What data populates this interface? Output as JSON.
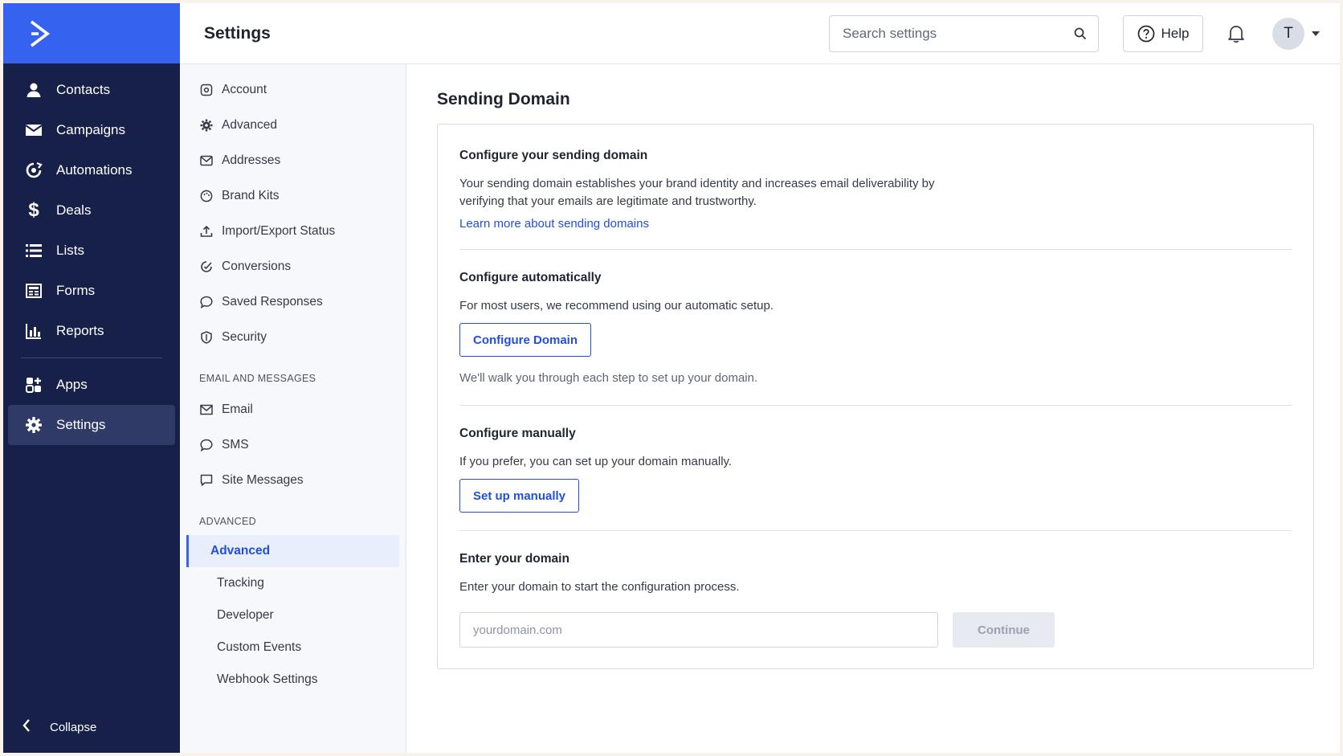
{
  "nav": {
    "items": [
      {
        "label": "Contacts",
        "icon": "person-icon"
      },
      {
        "label": "Campaigns",
        "icon": "envelope-icon"
      },
      {
        "label": "Automations",
        "icon": "automation-icon"
      },
      {
        "label": "Deals",
        "icon": "dollar-icon"
      },
      {
        "label": "Lists",
        "icon": "list-icon"
      },
      {
        "label": "Forms",
        "icon": "form-icon"
      },
      {
        "label": "Reports",
        "icon": "chart-icon"
      },
      {
        "label": "Apps",
        "icon": "apps-icon"
      },
      {
        "label": "Settings",
        "icon": "gear-icon",
        "active": true
      }
    ],
    "collapse_label": "Collapse",
    "colors": {
      "bg": "#162048",
      "logo_bg": "#3563f0",
      "active_bg": "#2f3b66"
    }
  },
  "topbar": {
    "title": "Settings",
    "search_placeholder": "Search settings",
    "help_label": "Help",
    "avatar_initial": "T"
  },
  "settings_nav": {
    "general": [
      "Account",
      "Advanced",
      "Addresses",
      "Brand Kits",
      "Import/Export Status",
      "Conversions",
      "Saved Responses",
      "Security"
    ],
    "email_section_title": "EMAIL AND MESSAGES",
    "email": [
      "Email",
      "SMS",
      "Site Messages"
    ],
    "advanced_section_title": "ADVANCED",
    "advanced": [
      "Advanced",
      "Tracking",
      "Developer",
      "Custom Events",
      "Webhook Settings"
    ],
    "active": "Advanced"
  },
  "content": {
    "page_title": "Sending Domain",
    "intro": {
      "heading": "Configure your sending domain",
      "body": "Your sending domain establishes your brand identity and increases email deliverability by verifying that your emails are legitimate and trustworthy.",
      "link": "Learn more about sending domains"
    },
    "auto": {
      "heading": "Configure automatically",
      "body": "For most users, we recommend using our automatic setup.",
      "button": "Configure Domain",
      "hint": "We'll walk you through each step to set up your domain."
    },
    "manual": {
      "heading": "Configure manually",
      "body": "If you prefer, you can set up your domain manually.",
      "button": "Set up manually"
    },
    "domain": {
      "heading": "Enter your domain",
      "body": "Enter your domain to start the configuration process.",
      "placeholder": "yourdomain.com",
      "value": "",
      "button": "Continue"
    },
    "accent_color": "#2150d6"
  }
}
